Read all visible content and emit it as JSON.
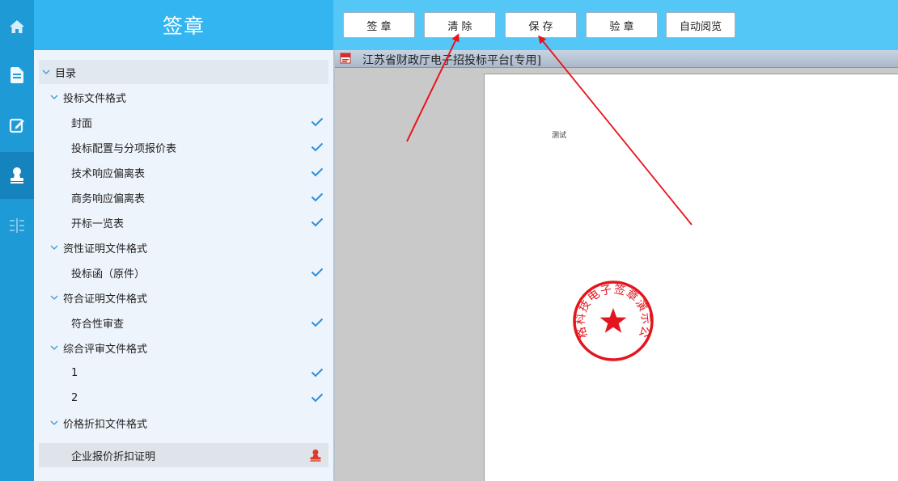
{
  "rail": {
    "items": [
      {
        "icon": "home-icon"
      },
      {
        "icon": "document-icon"
      },
      {
        "icon": "edit-icon"
      },
      {
        "icon": "stamp-icon",
        "active": true
      },
      {
        "icon": "compare-icon"
      }
    ]
  },
  "panel": {
    "title": "签章"
  },
  "tree": {
    "rows": [
      {
        "label": "目录",
        "level": 0,
        "expandable": true
      },
      {
        "label": "投标文件格式",
        "level": 1,
        "expandable": true
      },
      {
        "label": "封面",
        "level": 2,
        "status": "done"
      },
      {
        "label": "投标配置与分项报价表",
        "level": 2,
        "status": "done"
      },
      {
        "label": "技术响应偏离表",
        "level": 2,
        "status": "done"
      },
      {
        "label": "商务响应偏离表",
        "level": 2,
        "status": "done"
      },
      {
        "label": "开标一览表",
        "level": 2,
        "status": "done"
      },
      {
        "label": "资性证明文件格式",
        "level": 1,
        "expandable": true
      },
      {
        "label": "投标函（原件）",
        "level": 2,
        "status": "done"
      },
      {
        "label": "符合证明文件格式",
        "level": 1,
        "expandable": true
      },
      {
        "label": "符合性审查",
        "level": 2,
        "status": "done"
      },
      {
        "label": "综合评审文件格式",
        "level": 1,
        "expandable": true
      },
      {
        "label": "1",
        "level": 2,
        "status": "done"
      },
      {
        "label": "2",
        "level": 2,
        "status": "done"
      },
      {
        "label": "价格折扣文件格式",
        "level": 1,
        "expandable": true
      },
      {
        "label": "企业报价折扣证明",
        "level": 2,
        "status": "stamp",
        "selected": true
      }
    ]
  },
  "toolbar": {
    "buttons": [
      {
        "label": "签 章"
      },
      {
        "label": "清 除"
      },
      {
        "label": "保 存"
      },
      {
        "label": "验 章"
      },
      {
        "label": "自动阅览"
      }
    ]
  },
  "viewer": {
    "title": "江苏省财政厅电子招投标平台[专用]",
    "page_text": "测试",
    "seal_text": "金格科技电子签章演示公司"
  },
  "colors": {
    "rail": "#1e9ad6",
    "header": "#32b5f0",
    "toolbar": "#54c7f7",
    "check": "#2a8fe0",
    "seal": "#e3161f",
    "arrow": "#e8141c"
  }
}
